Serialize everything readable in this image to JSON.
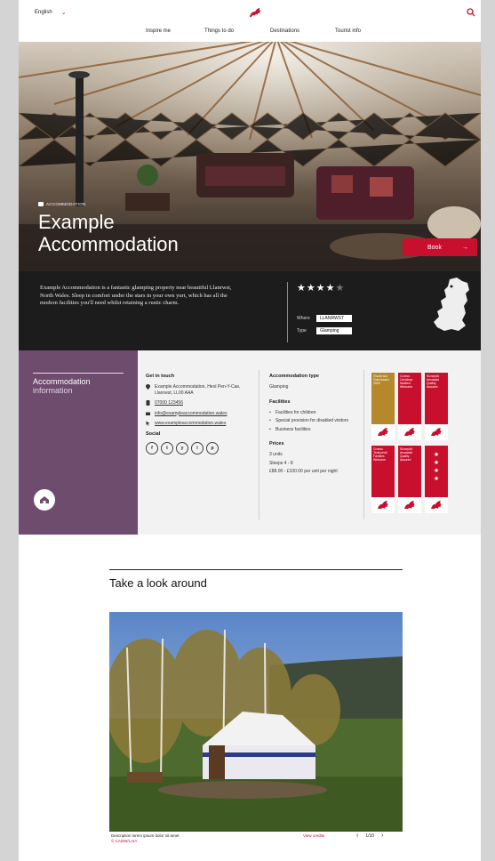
{
  "header": {
    "language": "English",
    "nav": [
      "Inspire me",
      "Things to do",
      "Destinations",
      "Tourist info"
    ]
  },
  "hero": {
    "tag": "ACCOMMODATION",
    "title_line1": "Example",
    "title_line2": "Accommodation",
    "book_label": "Book",
    "book_arrow": "→"
  },
  "summary": {
    "description": "Example Accommodation is a fantastic glamping property near beautiful Llanrwst, North Wales. Sleep in comfort under the stars in your own yurt, which has all the modern facilities you'll need whilst retaining a rustic charm.",
    "rating": 4,
    "rating_max": 5,
    "where_label": "Where",
    "where_value": "LLANRWST",
    "type_label": "Type",
    "type_value": "Glamping"
  },
  "info": {
    "heading_line1": "Accommodation",
    "heading_line2": "information",
    "contact_heading": "Get in touch",
    "address": "Example Accommodation, Heol Pen-Y-Cae, Llanrwst, LL00 AAA",
    "phone": "07000 123456",
    "email": "info@exampleaccommodation.wales",
    "website": "www.exampleaccommodation.wales",
    "social_heading": "Social",
    "social": [
      "f",
      "t",
      "y",
      "i",
      "p"
    ],
    "type_heading": "Accommodation type",
    "type_value": "Glamping",
    "facilities_heading": "Facilities",
    "facilities": [
      "Facilities for children",
      "Special provision for disabled visitors",
      "Business facilities"
    ],
    "prices_heading": "Prices",
    "units": "3 units",
    "sleeps": "Sleeps 4 - 8",
    "price": "£88.00 - £100.00 per unit per night"
  },
  "badges": [
    {
      "text": "Gwobr Aur Gold Award 2018",
      "color": "#b5892b"
    },
    {
      "text": "Croeso Cerddwyr Walkers Welcome",
      "color": "#c8102e"
    },
    {
      "text": "Sicrwydd Ansawdd Quality Assured",
      "color": "#c8102e"
    },
    {
      "text": "Croeso Teuluoedd Families Welcome",
      "color": "#c8102e"
    },
    {
      "text": "Sicrwydd Ansawdd Quality Assured",
      "color": "#c8102e"
    },
    {
      "text": "",
      "color": "#c8102e"
    }
  ],
  "gallery": {
    "heading": "Take a look around",
    "caption": "Description lorem ipsum dolor sit amet",
    "credit": "© CADW/LAIA",
    "view_credits": "View credits",
    "counter": "1/10",
    "prev": "‹",
    "next": "›"
  },
  "colors": {
    "brand_red": "#c8102e",
    "purple": "#6e4c6e",
    "dark": "#1c1c1c"
  }
}
